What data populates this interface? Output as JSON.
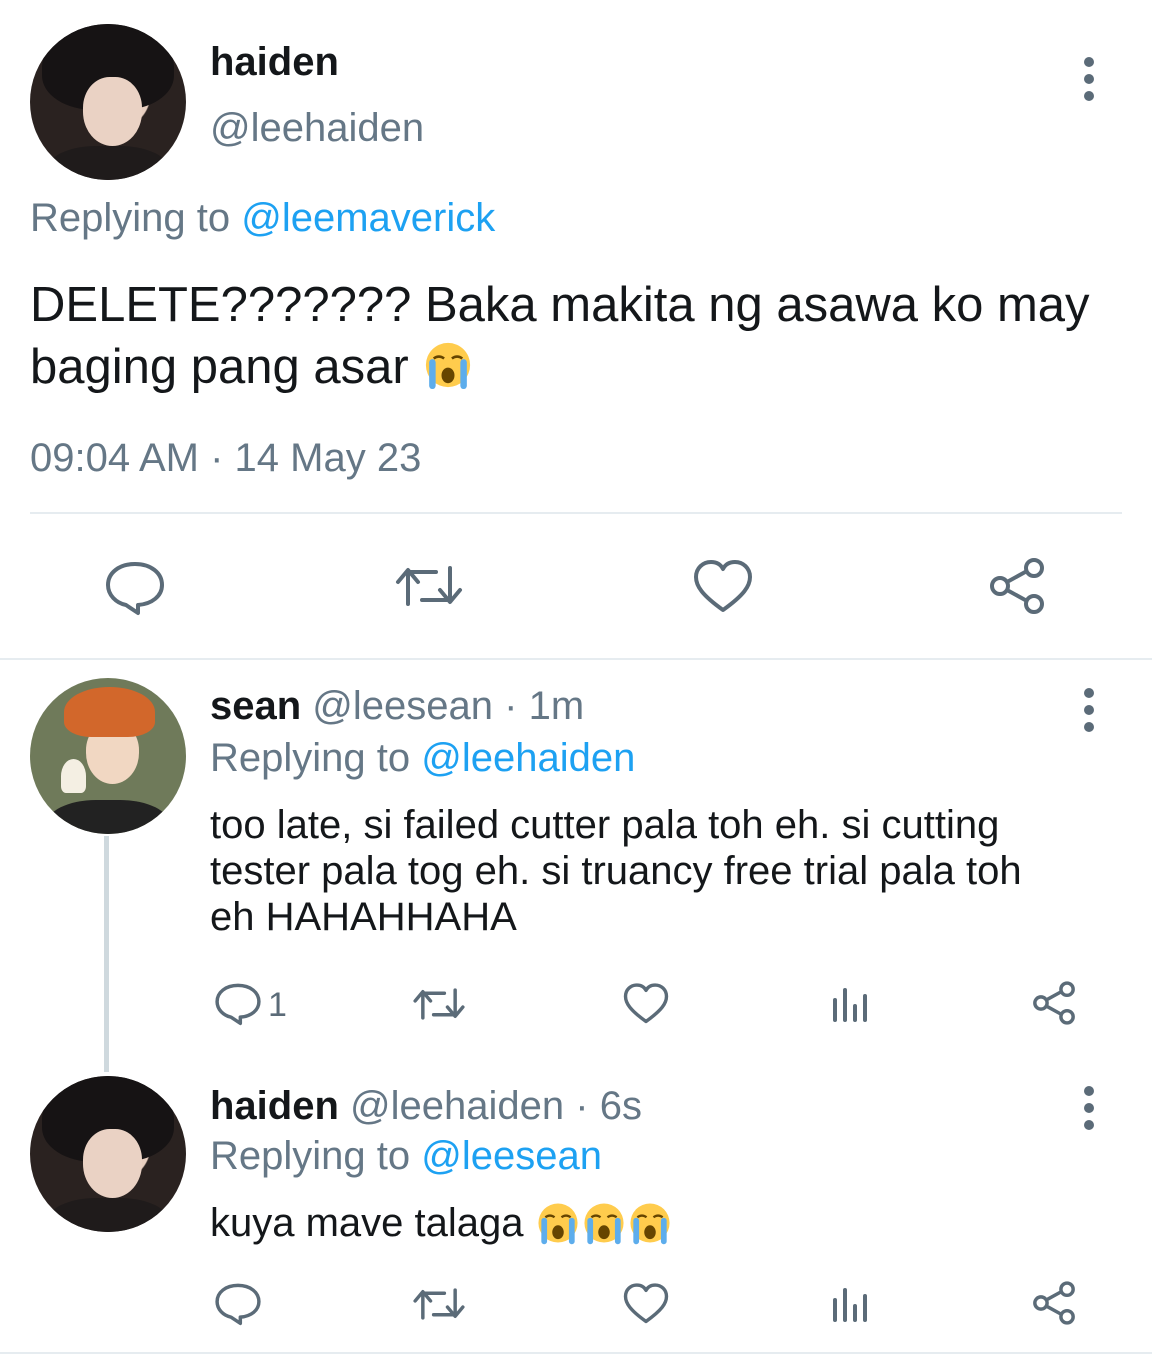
{
  "main_tweet": {
    "display_name": "haiden",
    "handle": "@leehaiden",
    "replying_prefix": "Replying to",
    "replying_to": "@leemaverick",
    "text_line1": "DELETE??????? Baka makita ng asawa ko may",
    "text_line2": "baging pang asar",
    "timestamp": "09:04 AM · 14 May 23",
    "actions": [
      "reply-icon",
      "retweet-icon",
      "like-icon",
      "share-icon"
    ]
  },
  "replies": [
    {
      "display_name": "sean",
      "handle": "@leesean",
      "time": "· 1m",
      "replying_prefix": "Replying to",
      "replying_to": "@leehaiden",
      "text_line1": "too late, si failed cutter pala toh eh. si cutting",
      "text_line2": "tester pala tog eh. si truancy free trial pala toh",
      "text_line3": "eh HAHAHHAHA",
      "reply_count": "1"
    },
    {
      "display_name": "haiden",
      "handle": "@leehaiden",
      "time": "· 6s",
      "replying_prefix": "Replying to",
      "replying_to": "@leesean",
      "text": "kuya mave talaga"
    }
  ],
  "colors": {
    "link": "#1da1f2",
    "muted": "#657786",
    "icon": "#5b6b78",
    "divider": "#e6ecf0"
  }
}
